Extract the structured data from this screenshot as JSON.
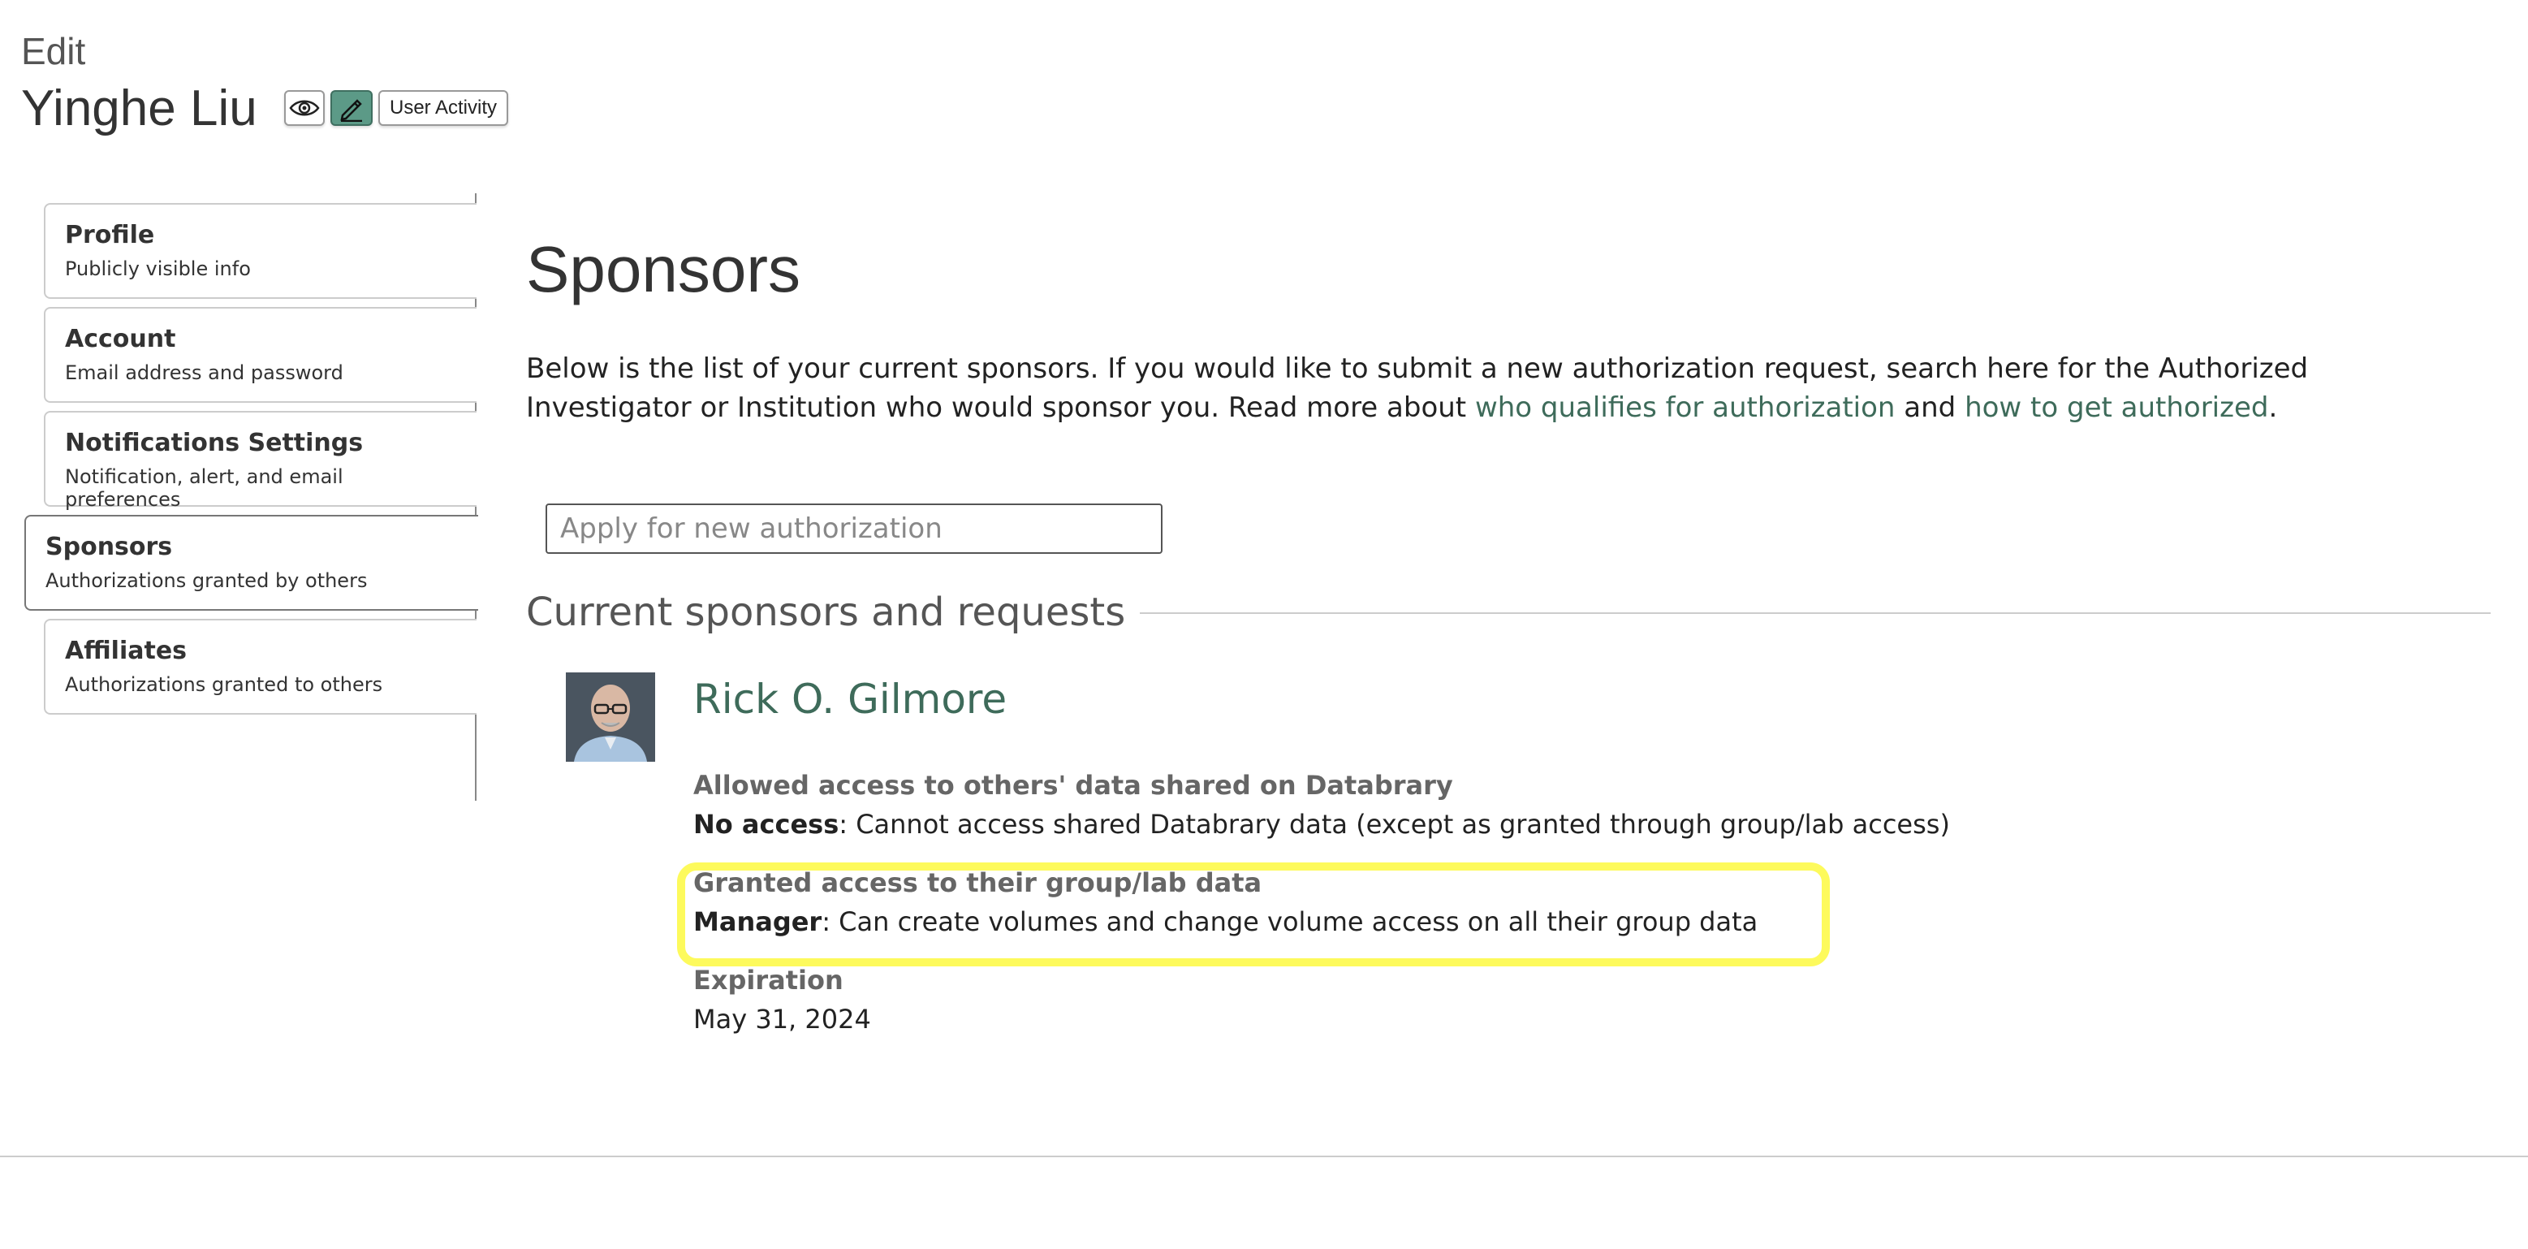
{
  "header": {
    "edit_label": "Edit",
    "user_name": "Yinghe Liu",
    "user_activity_label": "User Activity"
  },
  "sidebar": {
    "items": [
      {
        "title": "Profile",
        "desc": "Publicly visible info"
      },
      {
        "title": "Account",
        "desc": "Email address and password"
      },
      {
        "title": "Notifications Settings",
        "desc": "Notification, alert, and email preferences"
      },
      {
        "title": "Sponsors",
        "desc": "Authorizations granted by others"
      },
      {
        "title": "Affiliates",
        "desc": "Authorizations granted to others"
      }
    ],
    "active": "Sponsors"
  },
  "main": {
    "title": "Sponsors",
    "intro_part1": "Below is the list of your current sponsors. If you would like to submit a new authorization request, search here for the Authorized Investigator or Institution who would sponsor you. Read more about ",
    "intro_link1": "who qualifies for authorization",
    "intro_part2": " and ",
    "intro_link2": "how to get authorized",
    "intro_part3": ".",
    "search_placeholder": "Apply for new authorization",
    "section_heading": "Current sponsors and requests"
  },
  "sponsor": {
    "name": "Rick O. Gilmore",
    "access_others_heading": "Allowed access to others' data shared on Databrary",
    "access_others_level": "No access",
    "access_others_desc": ": Cannot access shared Databrary data (except as granted through group/lab access)",
    "group_access_heading": "Granted access to their group/lab data",
    "group_access_level": "Manager",
    "group_access_desc": ": Can create volumes and change volume access on all their group data",
    "expiration_heading": "Expiration",
    "expiration_date": "May 31, 2024"
  },
  "colors": {
    "link": "#3e6b5a",
    "highlight": "#fdfa5c",
    "edit_button": "#5c9a87"
  },
  "icons": {
    "view": "eye-icon",
    "edit": "pencil-icon"
  }
}
